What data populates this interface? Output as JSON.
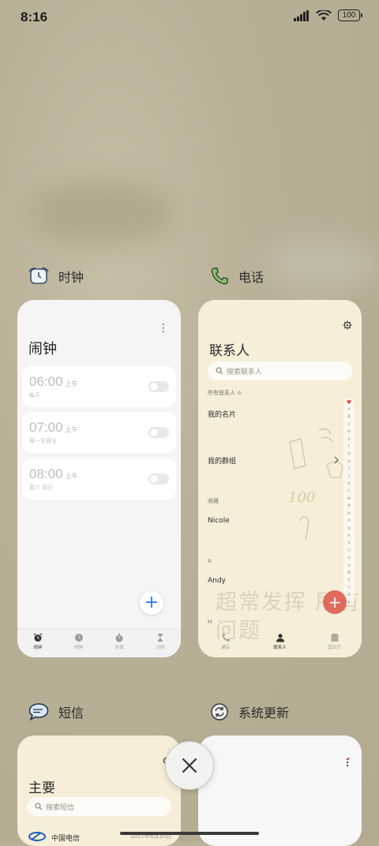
{
  "status": {
    "time": "8:16",
    "battery": "100"
  },
  "apps": {
    "clock": {
      "name": "时钟",
      "title": "闹钟",
      "menu": "⋮",
      "alarms": [
        {
          "time": "06:00",
          "ampm": "上午",
          "repeat": "每天"
        },
        {
          "time": "07:00",
          "ampm": "上午",
          "repeat": "周一至周五"
        },
        {
          "time": "08:00",
          "ampm": "上午",
          "repeat": "周六 周日"
        }
      ],
      "fab": "+",
      "tabs": [
        "闹钟",
        "时钟",
        "秒表",
        "计时"
      ]
    },
    "phone": {
      "name": "电话",
      "title": "联系人",
      "search_placeholder": "搜索联系人",
      "filter": "所有联系人 ≎",
      "my_card": "我的名片",
      "my_group": "我的群组",
      "favorites_label": "收藏",
      "favorite": "Nicole",
      "section_a": "A",
      "contact_a": "Andy",
      "section_h": "H",
      "alphabet": [
        "A",
        "B",
        "C",
        "D",
        "E",
        "F",
        "G",
        "H",
        "I",
        "J",
        "K",
        "L",
        "M",
        "N",
        "O",
        "P",
        "Q",
        "R",
        "S",
        "T",
        "U",
        "V",
        "W",
        "X",
        "Y",
        "Z",
        "#"
      ],
      "fab": "+",
      "tabs": [
        "通话",
        "联系人",
        "营业厅"
      ],
      "doodle": "超常发挥 所有问题"
    },
    "sms": {
      "name": "短信",
      "title": "主要",
      "search_placeholder": "搜索短信",
      "first_sender": "中国电信",
      "first_date": "2017年6月30日"
    },
    "update": {
      "name": "系统更新"
    }
  }
}
